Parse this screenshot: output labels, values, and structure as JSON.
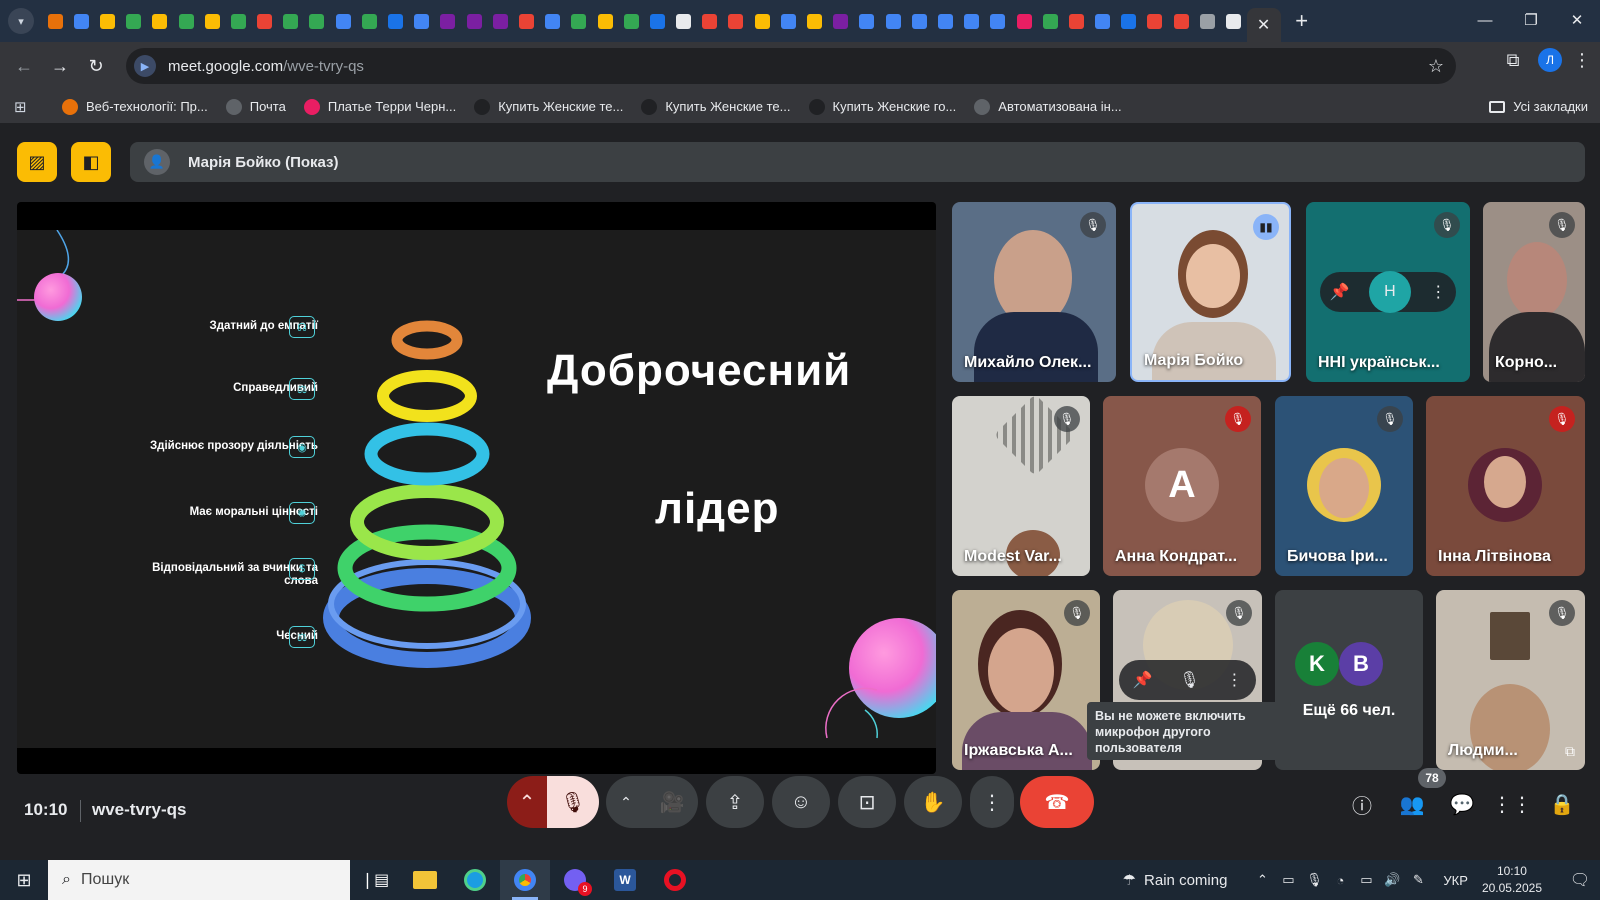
{
  "browser": {
    "url_host": "meet.google.com",
    "url_path": "/wve-tvry-qs",
    "active_tab_icon": "meet-present-icon",
    "bookmarks": [
      {
        "label": "Веб-технології: Пр...",
        "color": "#e8710a"
      },
      {
        "label": "Почта",
        "color": "#5f6368"
      },
      {
        "label": "Платье Терри Черн...",
        "color": "#e91e63"
      },
      {
        "label": "Купить Женские те...",
        "color": "#202124"
      },
      {
        "label": "Купить Женские те...",
        "color": "#202124"
      },
      {
        "label": "Купить Женские го...",
        "color": "#202124"
      },
      {
        "label": "Автоматизована ін...",
        "color": "#5f6368"
      }
    ],
    "all_bookmarks": "Усі закладки",
    "profile_initial": "Л"
  },
  "meet": {
    "presenter_label": "Марія Бойко (Показ)",
    "slide": {
      "title_line1": "Доброчесний",
      "title_line2": "лідер",
      "traits": [
        "Здатний до емпатії",
        "Справедливий",
        "Здійснює прозору діяльність",
        "Має моральні цінності",
        "Відповідальний за вчинки та слова",
        "Чесний"
      ]
    },
    "participants": [
      {
        "name": "Михайло Олек...",
        "muted": true
      },
      {
        "name": "Марія Бойко",
        "speaking": true
      },
      {
        "name": "ННІ українськ...",
        "muted": true
      },
      {
        "name": "Корно...",
        "muted": true
      },
      {
        "name": "Modest Var...",
        "muted": true
      },
      {
        "name": "Анна Кондрат...",
        "initial": "А",
        "muted": true
      },
      {
        "name": "Бичова Іри...",
        "muted": true
      },
      {
        "name": "Інна Літвінова",
        "muted": true
      },
      {
        "name": "Іржавська А...",
        "muted": true
      },
      {
        "name": "",
        "muted": true
      },
      {
        "name": "Людми...",
        "muted": true
      }
    ],
    "others": {
      "label": "Ещё 66 чел.",
      "initials": [
        "K",
        "B"
      ]
    },
    "tooltip": "Вы не можете включить микрофон другого пользователя",
    "clock": "10:10",
    "meeting_code": "wve-tvry-qs",
    "people_count": "78"
  },
  "taskbar": {
    "search_placeholder": "Пошук",
    "weather": "Rain coming",
    "language": "УКР",
    "time": "10:10",
    "date": "20.05.2025",
    "viber_badge": "9"
  },
  "colors": {
    "meet_bg": "#202124",
    "accent_yellow": "#fbbc04",
    "end_call": "#ea4335",
    "tile_bg": "#3c4043"
  }
}
